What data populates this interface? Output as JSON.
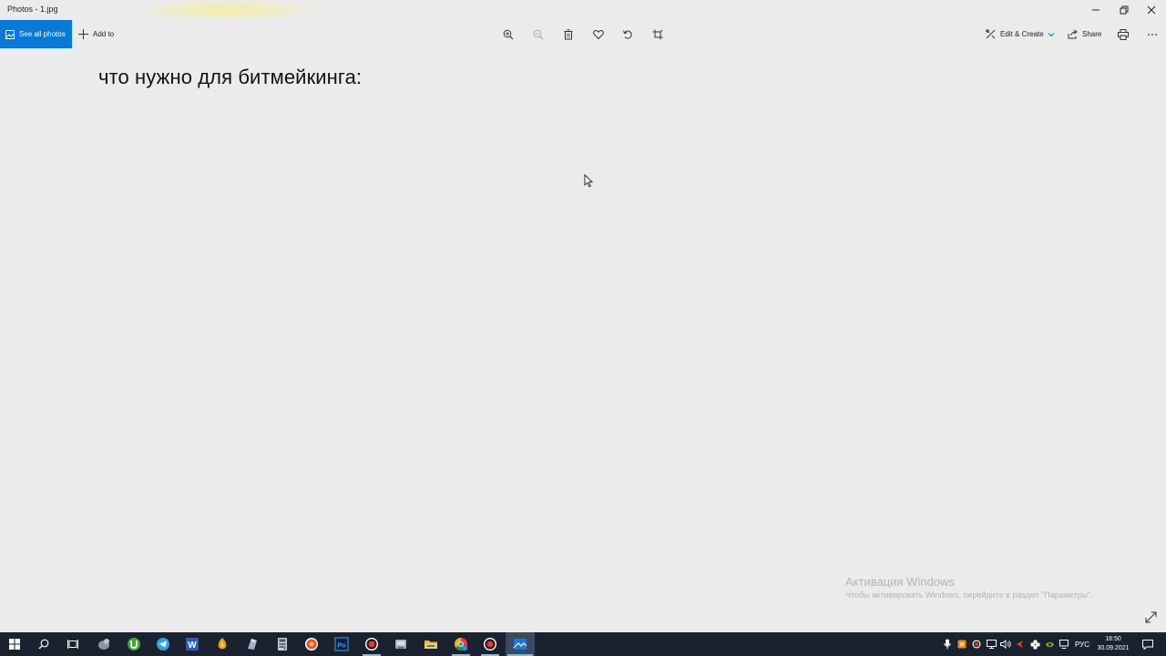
{
  "window": {
    "title": "Photos - 1.jpg"
  },
  "toolbar": {
    "see_all_photos": "See all photos",
    "add_to": "Add to",
    "edit_create": "Edit & Create",
    "share": "Share"
  },
  "photo": {
    "text": "что нужно для битмейкинга:"
  },
  "watermark": {
    "title": "Активация Windows",
    "subtitle": "Чтобы активировать Windows, перейдите в раздел \"Параметры\"."
  },
  "taskbar": {
    "apps": [
      "start-icon",
      "search-icon",
      "task-view-icon",
      "app-icon",
      "utorrent-icon",
      "telegram-icon",
      "word-icon",
      "fl-studio-icon",
      "app-icon",
      "calculator-icon",
      "app-icon",
      "photoshop-icon",
      "record-icon",
      "app-icon",
      "file-explorer-icon",
      "chrome-icon",
      "record-icon",
      "photos-icon"
    ],
    "language": "РУС",
    "time": "18:50",
    "date": "30.09.2021"
  },
  "colors": {
    "accent": "#0a78d7",
    "background": "#ebebeb",
    "taskbar": "#1a2230"
  }
}
